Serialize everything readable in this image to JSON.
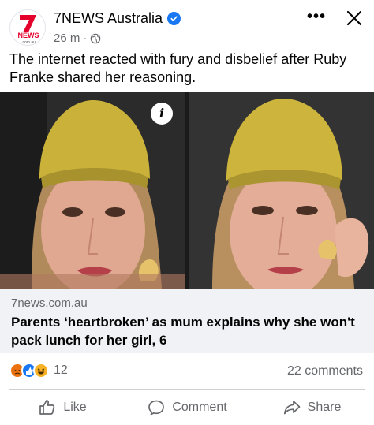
{
  "post": {
    "page_name": "7NEWS Australia",
    "avatar_text": "NEWS",
    "avatar_subtext": ".com.au",
    "timestamp": "26 m",
    "separator": "·",
    "more_label": "•••",
    "caption": "The internet reacted with fury and disbelief after Ruby Franke shared her reasoning."
  },
  "media": {
    "info_label": "i"
  },
  "link": {
    "domain": "7news.com.au",
    "title": "Parents ‘heartbroken’ as mum explains why she won't pack lunch for her girl, 6"
  },
  "stats": {
    "reaction_count": "12",
    "comments": "22 comments",
    "reaction_icons": [
      "angry-icon",
      "like-icon",
      "haha-icon"
    ]
  },
  "actions": {
    "like": "Like",
    "comment": "Comment",
    "share": "Share"
  },
  "colors": {
    "brand_red": "#e4002b",
    "verified_blue": "#1877f2",
    "secondary_text": "#65676b",
    "link_bg": "#f0f2f5"
  }
}
